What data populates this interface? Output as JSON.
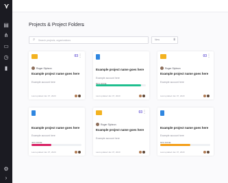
{
  "page_title": "Projects & Project Folders",
  "search": {
    "placeholder": "Search projects, organizations"
  },
  "filter": {
    "label": "New"
  },
  "cards": [
    {
      "kind": "folder",
      "count": "03",
      "owner": "Roger Siphron",
      "name": "Example project name goes here",
      "account": "Example account here",
      "updated": "Last updated Jan 07, 2020"
    },
    {
      "kind": "doc",
      "name": "Example project name goes here",
      "account": "Example account here",
      "progress_label": "80% DONE",
      "progress": 0.9,
      "progress_color": "#1fbf8f",
      "updated": "Last updated Jan 07, 2020"
    },
    {
      "kind": "folder",
      "count": "03",
      "owner": "Roger Siphron",
      "name": "Example project name goes here",
      "account": "Example account here",
      "updated": "Last updated Jan 07, 2020"
    },
    {
      "kind": "doc",
      "name": "Example project name goes here",
      "account": "Example account here",
      "progress_label": "40% DONE",
      "progress": 0.4,
      "progress_color": "#d81b60",
      "updated": "Last updated Jan 07, 2020"
    },
    {
      "kind": "folder",
      "count": "03",
      "owner": "Roger Siphron",
      "name": "Example project name goes here",
      "account": "Example account here",
      "updated": "Last updated Jan 07, 2020"
    },
    {
      "kind": "doc",
      "name": "Example project name goes here",
      "account": "Example account here",
      "progress_label": "60% DONE",
      "progress": 0.6,
      "progress_color": "#f39c12",
      "updated": "Last updated Jan 07, 2020"
    }
  ]
}
